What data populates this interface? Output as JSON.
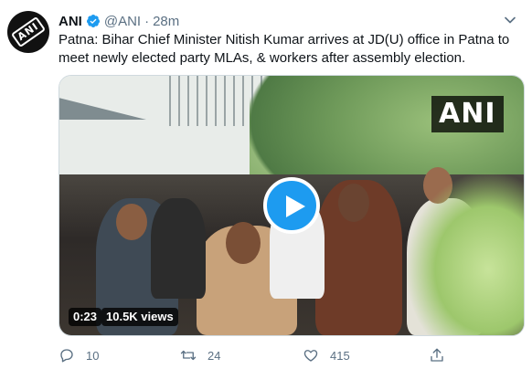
{
  "tweet": {
    "author_name": "ANI",
    "author_handle": "@ANI",
    "separator": "·",
    "timestamp": "28m",
    "text_line1": "Patna: Bihar Chief Minister Nitish Kumar arrives at JD(U) office in Patna to",
    "text_line2": "meet newly elected party MLAs, & workers after assembly election."
  },
  "avatar": {
    "logo_text": "ANI"
  },
  "media": {
    "watermark": "ANI",
    "duration": "0:23",
    "views": "10.5K views",
    "play_color": "#1d9bf0"
  },
  "actions": {
    "replies": "10",
    "retweets": "24",
    "likes": "415"
  },
  "colors": {
    "text": "#0f1419",
    "secondary": "#5b7083",
    "accent": "#1d9bf0"
  },
  "icons": [
    "verified-badge-icon",
    "chevron-down-icon",
    "play-icon",
    "reply-icon",
    "retweet-icon",
    "like-icon",
    "share-icon"
  ]
}
